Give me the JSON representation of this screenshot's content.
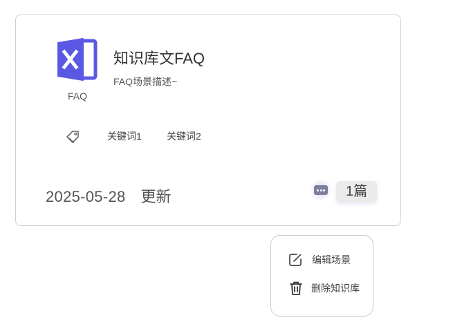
{
  "card": {
    "file_type": "FAQ",
    "title": "知识库文FAQ",
    "description": "FAQ场景描述~",
    "keywords": [
      "关键词1",
      "关键词2"
    ],
    "updated_date": "2025-05-28",
    "updated_label": "更新",
    "doc_count": "1篇"
  },
  "menu": {
    "items": [
      {
        "label": "编辑场景",
        "icon": "edit-icon"
      },
      {
        "label": "删除知识库",
        "icon": "trash-icon"
      }
    ]
  },
  "colors": {
    "accent": "#5b59e4",
    "border": "#cfcfd4",
    "badge_bg": "#ebebeb"
  }
}
